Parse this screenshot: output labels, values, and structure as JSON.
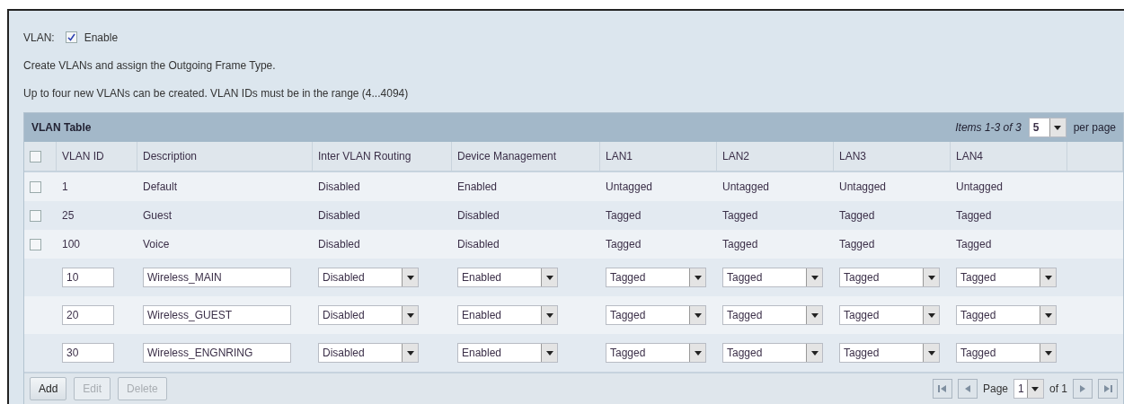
{
  "vlan": {
    "label": "VLAN:",
    "checked": true,
    "option_label": "Enable"
  },
  "intro": [
    "Create VLANs and assign the Outgoing Frame Type.",
    "Up to four new VLANs can be created. VLAN IDs must be in the range (4...4094)"
  ],
  "table": {
    "title": "VLAN Table",
    "items_text": "Items 1-3 of 3",
    "per_page": "5",
    "per_page_label": "per page",
    "select_all_checked": false,
    "columns": [
      "VLAN ID",
      "Description",
      "Inter VLAN Routing",
      "Device Management",
      "LAN1",
      "LAN2",
      "LAN3",
      "LAN4"
    ],
    "rows": [
      {
        "kind": "static",
        "checked": false,
        "cells": [
          "1",
          "Default",
          "Disabled",
          "Enabled",
          "Untagged",
          "Untagged",
          "Untagged",
          "Untagged"
        ]
      },
      {
        "kind": "static",
        "checked": false,
        "cells": [
          "25",
          "Guest",
          "Disabled",
          "Disabled",
          "Tagged",
          "Tagged",
          "Tagged",
          "Tagged"
        ]
      },
      {
        "kind": "static",
        "checked": false,
        "cells": [
          "100",
          "Voice",
          "Disabled",
          "Disabled",
          "Tagged",
          "Tagged",
          "Tagged",
          "Tagged"
        ]
      },
      {
        "kind": "edit",
        "cells": [
          "10",
          "Wireless_MAIN",
          "Disabled",
          "Enabled",
          "Tagged",
          "Tagged",
          "Tagged",
          "Tagged"
        ]
      },
      {
        "kind": "edit",
        "cells": [
          "20",
          "Wireless_GUEST",
          "Disabled",
          "Enabled",
          "Tagged",
          "Tagged",
          "Tagged",
          "Tagged"
        ]
      },
      {
        "kind": "edit",
        "cells": [
          "30",
          "Wireless_ENGNRING",
          "Disabled",
          "Enabled",
          "Tagged",
          "Tagged",
          "Tagged",
          "Tagged"
        ]
      }
    ],
    "buttons": [
      {
        "label": "Add",
        "disabled": false
      },
      {
        "label": "Edit",
        "disabled": true
      },
      {
        "label": "Delete",
        "disabled": true
      }
    ],
    "pagination": {
      "page_label": "Page",
      "page": "1",
      "of_text": "of 1"
    }
  }
}
